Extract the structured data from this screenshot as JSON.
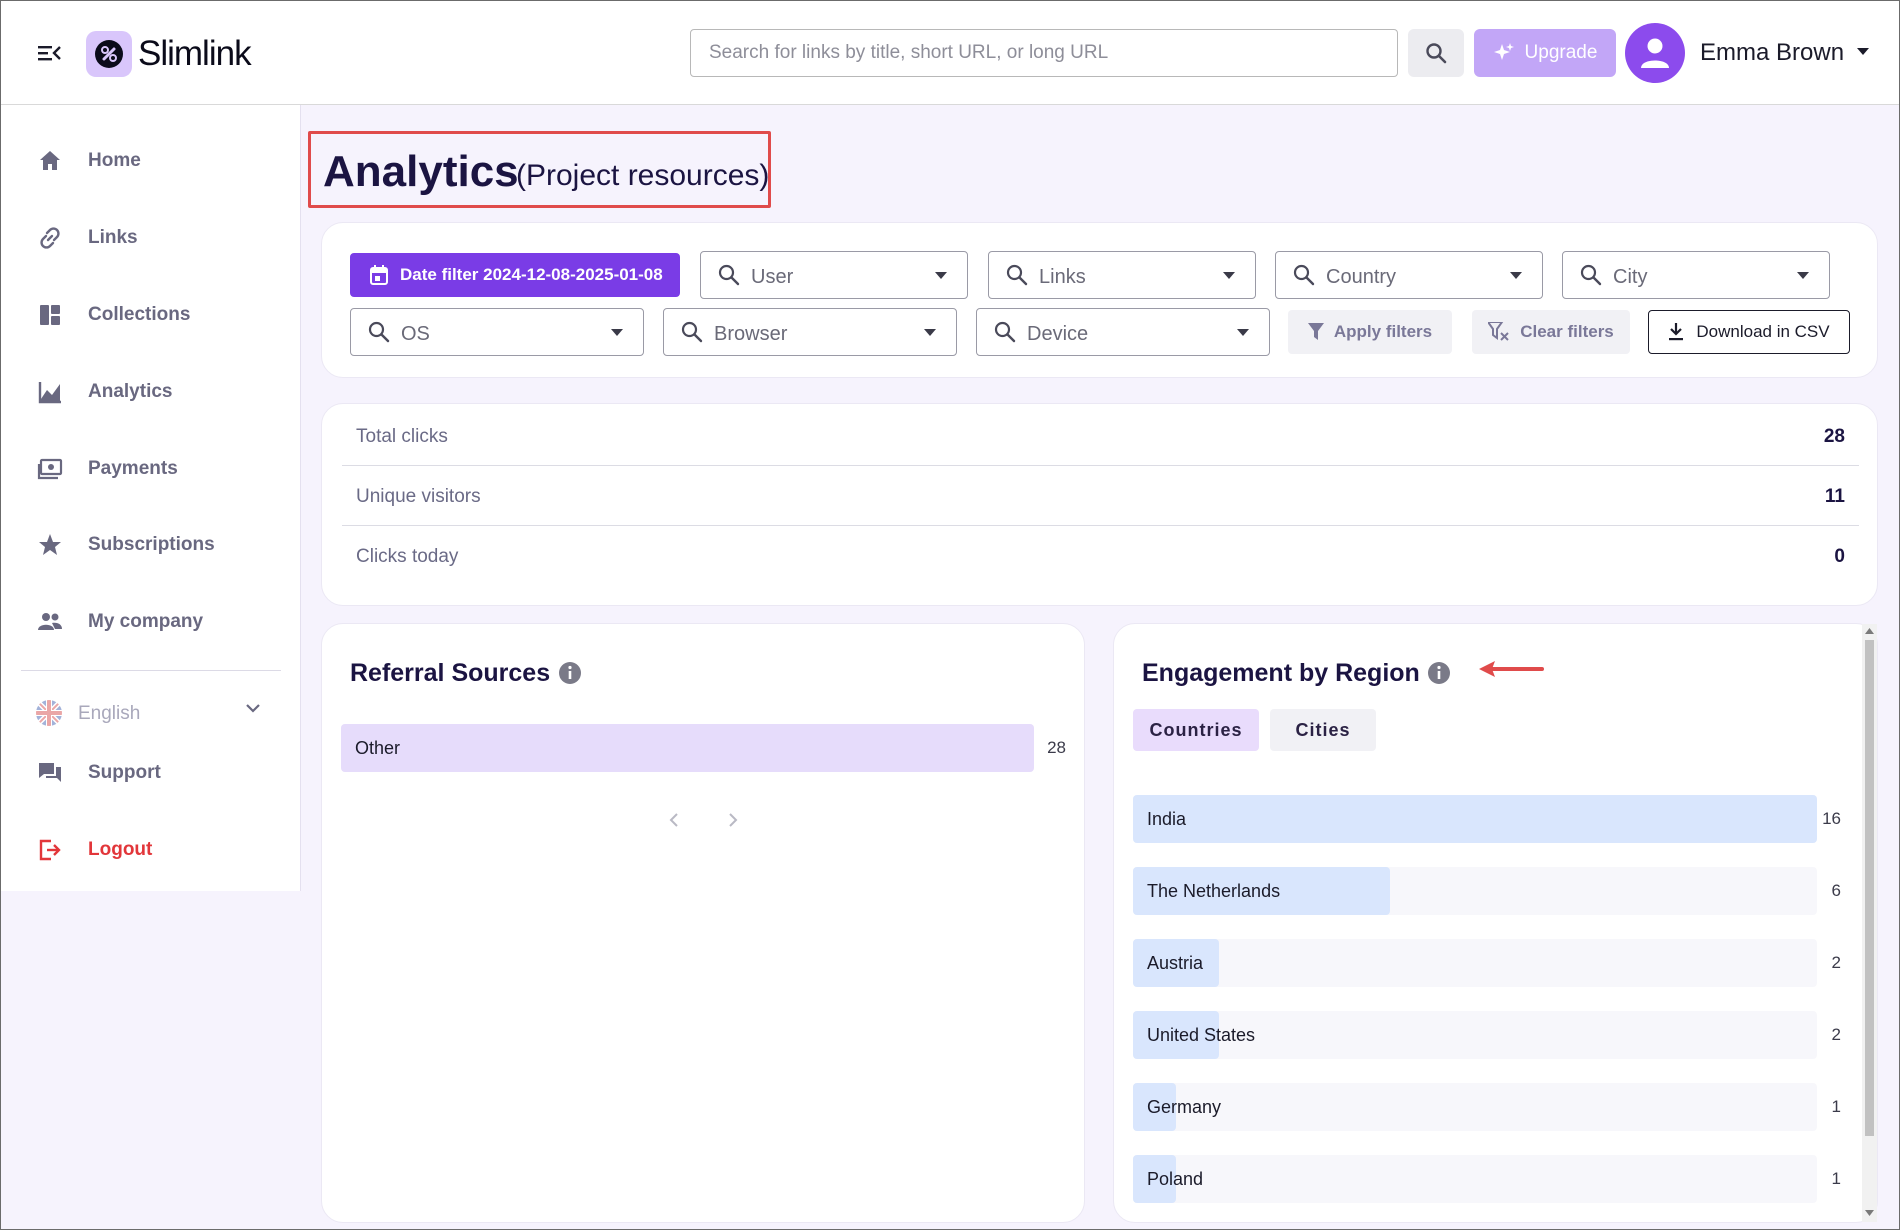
{
  "app": {
    "name": "Slimlink"
  },
  "header": {
    "search_placeholder": "Search for links by title, short URL, or long URL",
    "upgrade_label": "Upgrade",
    "user_name": "Emma Brown"
  },
  "sidebar": {
    "items": [
      {
        "label": "Home",
        "icon": "home-icon"
      },
      {
        "label": "Links",
        "icon": "link-icon"
      },
      {
        "label": "Collections",
        "icon": "collections-icon"
      },
      {
        "label": "Analytics",
        "icon": "analytics-icon"
      },
      {
        "label": "Payments",
        "icon": "payments-icon"
      },
      {
        "label": "Subscriptions",
        "icon": "star-icon"
      },
      {
        "label": "My company",
        "icon": "people-icon"
      }
    ],
    "language": "English",
    "support_label": "Support",
    "logout_label": "Logout"
  },
  "page": {
    "title": "Analytics",
    "subtitle": "(Project resources)"
  },
  "filters": {
    "date_filter_label": "Date filter 2024-12-08-2025-01-08",
    "user": "User",
    "links": "Links",
    "country": "Country",
    "city": "City",
    "os": "OS",
    "browser": "Browser",
    "device": "Device",
    "apply_label": "Apply filters",
    "clear_label": "Clear filters",
    "csv_label": "Download in CSV"
  },
  "stats": [
    {
      "label": "Total clicks",
      "value": "28"
    },
    {
      "label": "Unique visitors",
      "value": "11"
    },
    {
      "label": "Clicks today",
      "value": "0"
    }
  ],
  "referral": {
    "title": "Referral Sources",
    "rows": [
      {
        "label": "Other",
        "value": 28
      }
    ]
  },
  "region": {
    "title": "Engagement by Region",
    "tabs": [
      "Countries",
      "Cities"
    ],
    "active_tab": "Countries",
    "rows": [
      {
        "label": "India",
        "value": 16
      },
      {
        "label": "The Netherlands",
        "value": 6
      },
      {
        "label": "Austria",
        "value": 2
      },
      {
        "label": "United States",
        "value": 2
      },
      {
        "label": "Germany",
        "value": 1
      },
      {
        "label": "Poland",
        "value": 1
      }
    ]
  },
  "colors": {
    "accent": "#7a3ce6",
    "referral_bar": "#e6dcfb",
    "region_bar": "#d9e6fd",
    "logout": "#e2363a",
    "annotation": "#e04b4b"
  }
}
